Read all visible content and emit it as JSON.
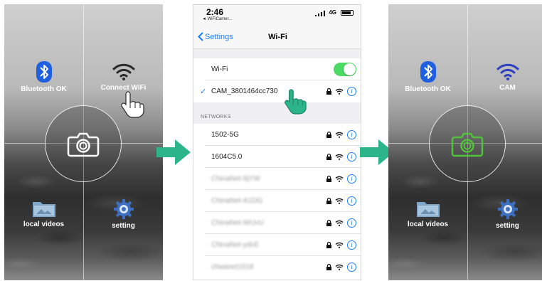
{
  "left_screen": {
    "bluetooth_label": "Bluetooth OK",
    "wifi_label": "Connect WiFi",
    "videos_label": "local videos",
    "setting_label": "setting"
  },
  "phone": {
    "time": "2:46",
    "back_app": "◄ WiFiCamer...",
    "network_type": "4G",
    "nav_back": "Settings",
    "nav_title": "Wi-Fi",
    "wifi_label": "Wi-Fi",
    "wifi_enabled": true,
    "connected_network": "CAM_3801464cc730",
    "networks_header": "NETWORKS",
    "networks": [
      {
        "name": "1502-5G",
        "blurred": false
      },
      {
        "name": "1604C5.0",
        "blurred": false
      },
      {
        "name": "ChinaNet-9jYW",
        "blurred": true
      },
      {
        "name": "ChinaNet-A1DG",
        "blurred": true
      },
      {
        "name": "ChinaNet-WUvU",
        "blurred": true
      },
      {
        "name": "ChinaNet-ydcE",
        "blurred": true
      },
      {
        "name": "chwanet1518",
        "blurred": true
      }
    ]
  },
  "right_screen": {
    "bluetooth_label": "Bluetooth OK",
    "wifi_label": "CAM",
    "videos_label": "local videos",
    "setting_label": "setting"
  },
  "colors": {
    "arrow": "#2db58a",
    "ios_blue": "#1a7cf5",
    "toggle_on": "#4cd964",
    "camera_active": "#52c23a",
    "wifi_connected": "#2f3fc0",
    "bluetooth": "#1f5fe0"
  }
}
